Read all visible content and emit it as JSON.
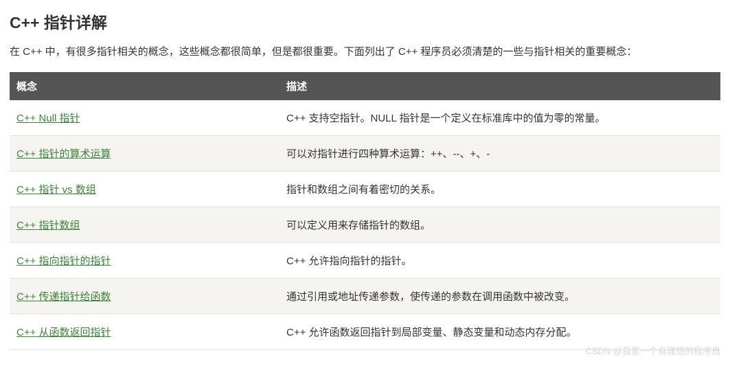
{
  "title": "C++ 指针详解",
  "intro": "在 C++ 中，有很多指针相关的概念，这些概念都很简单，但是都很重要。下面列出了 C++ 程序员必须清楚的一些与指针相关的重要概念：",
  "table": {
    "headers": {
      "concept": "概念",
      "description": "描述"
    },
    "rows": [
      {
        "link": "C++ Null 指针",
        "desc": "C++ 支持空指针。NULL 指针是一个定义在标准库中的值为零的常量。"
      },
      {
        "link": "C++ 指针的算术运算",
        "desc": "可以对指针进行四种算术运算：++、--、+、-"
      },
      {
        "link": "C++ 指针 vs 数组",
        "desc": "指针和数组之间有着密切的关系。"
      },
      {
        "link": "C++ 指针数组",
        "desc": "可以定义用来存储指针的数组。"
      },
      {
        "link": "C++ 指向指针的指针",
        "desc": "C++ 允许指向指针的指针。"
      },
      {
        "link": "C++ 传递指针给函数",
        "desc": "通过引用或地址传递参数，使传递的参数在调用函数中被改变。"
      },
      {
        "link": "C++ 从函数返回指针",
        "desc": "C++ 允许函数返回指针到局部变量、静态变量和动态内存分配。"
      }
    ]
  },
  "watermark": "CSDN @我是一个有理想的程序员"
}
